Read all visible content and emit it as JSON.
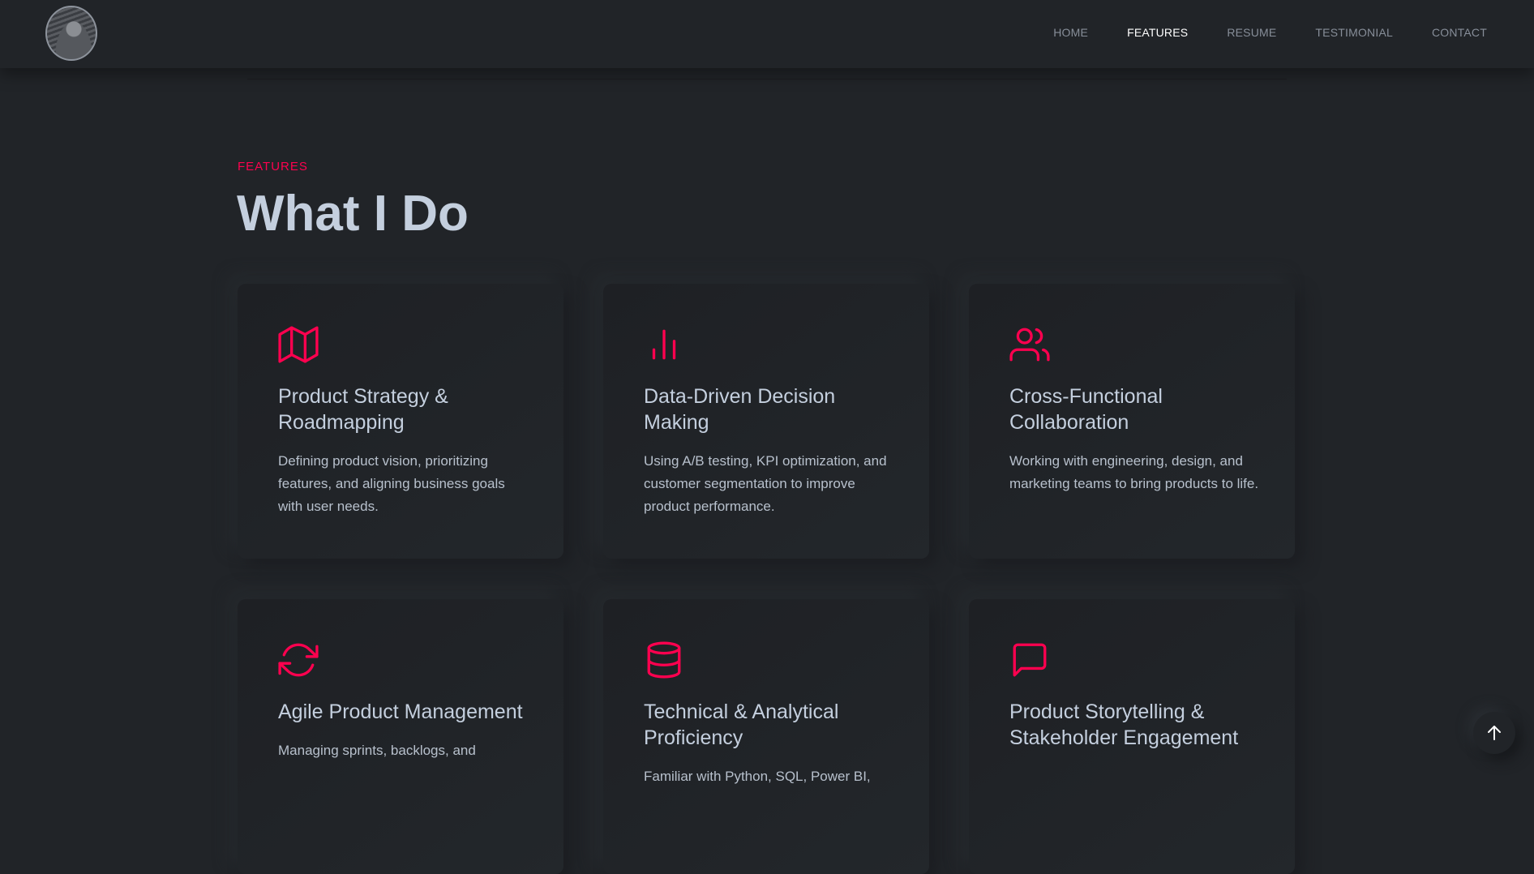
{
  "nav": {
    "items": [
      {
        "label": "HOME",
        "active": false
      },
      {
        "label": "FEATURES",
        "active": true
      },
      {
        "label": "RESUME",
        "active": false
      },
      {
        "label": "TESTIMONIAL",
        "active": false
      },
      {
        "label": "CONTACT",
        "active": false
      }
    ]
  },
  "section": {
    "label": "FEATURES",
    "title": "What I Do"
  },
  "cards": [
    {
      "icon": "map-icon",
      "title": "Product Strategy & Roadmapping",
      "description": "Defining product vision, prioritizing features, and aligning business goals with user needs."
    },
    {
      "icon": "bar-chart-icon",
      "title": "Data-Driven Decision Making",
      "description": "Using A/B testing, KPI optimization, and customer segmentation to improve product performance."
    },
    {
      "icon": "users-icon",
      "title": "Cross-Functional Collaboration",
      "description": "Working with engineering, design, and marketing teams to bring products to life."
    },
    {
      "icon": "refresh-icon",
      "title": "Agile Product Management",
      "description": "Managing sprints, backlogs, and"
    },
    {
      "icon": "database-icon",
      "title": "Technical & Analytical Proficiency",
      "description": "Familiar with Python, SQL, Power BI,"
    },
    {
      "icon": "message-square-icon",
      "title": "Product Storytelling & Stakeholder Engagement",
      "description": ""
    }
  ],
  "colors": {
    "accent": "#ff014f",
    "background": "#212428",
    "heading": "#c4cfde",
    "body_text": "#b7c0cc",
    "nav_text": "#878e99"
  }
}
